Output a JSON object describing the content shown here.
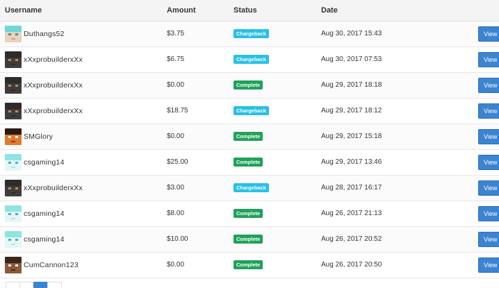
{
  "columns": {
    "username": "Username",
    "amount": "Amount",
    "status": "Status",
    "date": "Date"
  },
  "view_label": "View",
  "colors": {
    "chargeback": "#29c0e6",
    "complete": "#1fa25a",
    "view_button": "#3c84cf"
  },
  "rows": [
    {
      "username": "Duthangs52",
      "amount": "$3.75",
      "status": "Chargeback",
      "date": "Aug 30, 2017 15:43",
      "avatar": "cyan"
    },
    {
      "username": "xXxprobuilderxXx",
      "amount": "$6.75",
      "status": "Chargeback",
      "date": "Aug 30, 2017 07:53",
      "avatar": "dark"
    },
    {
      "username": "xXxprobuilderxXx",
      "amount": "$0.00",
      "status": "Complete",
      "date": "Aug 29, 2017 18:18",
      "avatar": "dark"
    },
    {
      "username": "xXxprobuilderxXx",
      "amount": "$18.75",
      "status": "Chargeback",
      "date": "Aug 29, 2017 18:12",
      "avatar": "dark"
    },
    {
      "username": "SMGlory",
      "amount": "$0.00",
      "status": "Complete",
      "date": "Aug 29, 2017 15:18",
      "avatar": "orange"
    },
    {
      "username": "csgaming14",
      "amount": "$25.00",
      "status": "Complete",
      "date": "Aug 29, 2017 13:46",
      "avatar": "light-cyan"
    },
    {
      "username": "xXxprobuilderxXx",
      "amount": "$3.00",
      "status": "Chargeback",
      "date": "Aug 28, 2017 16:17",
      "avatar": "dark"
    },
    {
      "username": "csgaming14",
      "amount": "$8.00",
      "status": "Complete",
      "date": "Aug 26, 2017 21:13",
      "avatar": "light-cyan"
    },
    {
      "username": "csgaming14",
      "amount": "$10.00",
      "status": "Complete",
      "date": "Aug 26, 2017 20:52",
      "avatar": "light-cyan"
    },
    {
      "username": "CumCannon123",
      "amount": "$0.00",
      "status": "Complete",
      "date": "Aug 26, 2017 20:50",
      "avatar": "brown"
    }
  ]
}
